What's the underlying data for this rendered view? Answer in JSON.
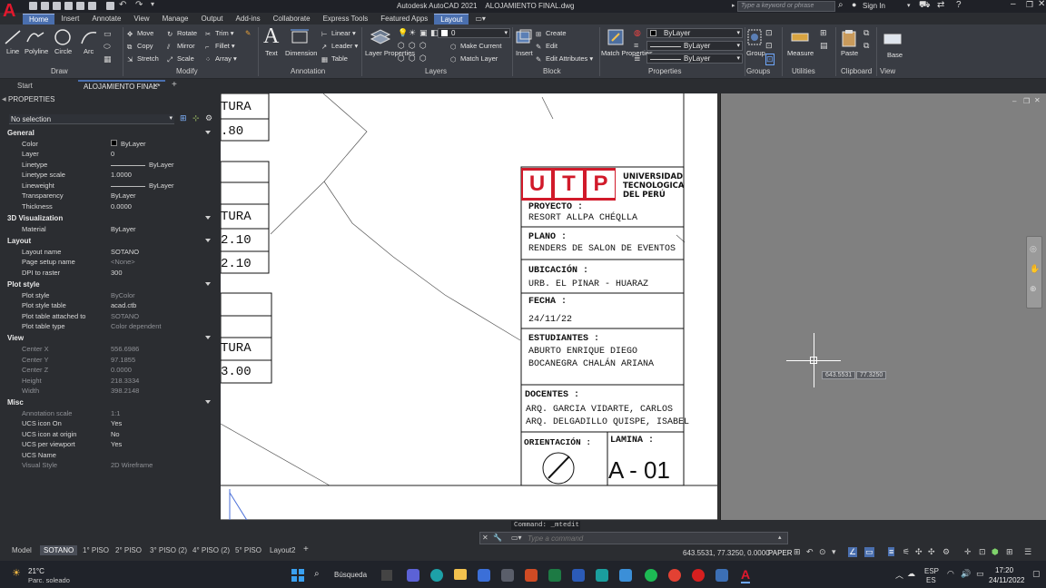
{
  "titlebar": {
    "app_title": "Autodesk AutoCAD 2021",
    "file_name": "ALOJAMIENTO FINAL.dwg",
    "search_placeholder": "Type a keyword or phrase",
    "sign_in": "Sign In"
  },
  "ribbon_tabs": [
    "Home",
    "Insert",
    "Annotate",
    "View",
    "Manage",
    "Output",
    "Add-ins",
    "Collaborate",
    "Express Tools",
    "Featured Apps",
    "Layout"
  ],
  "ribbon": {
    "draw": {
      "title": "Draw",
      "line": "Line",
      "polyline": "Polyline",
      "circle": "Circle",
      "arc": "Arc"
    },
    "modify": {
      "title": "Modify",
      "move": "Move",
      "rotate": "Rotate",
      "trim": "Trim",
      "copy": "Copy",
      "mirror": "Mirror",
      "fillet": "Fillet",
      "stretch": "Stretch",
      "scale": "Scale",
      "array": "Array"
    },
    "annotation": {
      "title": "Annotation",
      "text": "Text",
      "dimension": "Dimension",
      "linear": "Linear",
      "leader": "Leader",
      "table": "Table"
    },
    "layers": {
      "title": "Layers",
      "layer_properties": "Layer Properties",
      "current_layer": "0",
      "make_current": "Make Current",
      "match_layer": "Match Layer"
    },
    "block": {
      "title": "Block",
      "insert": "Insert",
      "create": "Create",
      "edit": "Edit",
      "edit_attributes": "Edit Attributes"
    },
    "properties": {
      "title": "Properties",
      "match_properties": "Match Properties",
      "color": "ByLayer",
      "lineweight": "ByLayer",
      "linetype": "ByLayer"
    },
    "groups": {
      "title": "Groups",
      "group": "Group"
    },
    "utilities": {
      "title": "Utilities",
      "measure": "Measure"
    },
    "clipboard": {
      "title": "Clipboard",
      "paste": "Paste"
    },
    "view": {
      "title": "View",
      "base": "Base"
    }
  },
  "doc_tabs": {
    "start": "Start",
    "active": "ALOJAMIENTO FINAL*"
  },
  "properties": {
    "title": "PROPERTIES",
    "selection": "No selection",
    "sections": {
      "general": "General",
      "viz3d": "3D Visualization",
      "layout": "Layout",
      "plotstyle": "Plot style",
      "view": "View",
      "misc": "Misc"
    },
    "rows": {
      "color": [
        "Color",
        "ByLayer"
      ],
      "layer": [
        "Layer",
        "0"
      ],
      "linetype": [
        "Linetype",
        "ByLayer"
      ],
      "linetype_scale": [
        "Linetype scale",
        "1.0000"
      ],
      "lineweight": [
        "Lineweight",
        "ByLayer"
      ],
      "transparency": [
        "Transparency",
        "ByLayer"
      ],
      "thickness": [
        "Thickness",
        "0.0000"
      ],
      "material": [
        "Material",
        "ByLayer"
      ],
      "layout_name": [
        "Layout name",
        "SOTANO"
      ],
      "page_setup": [
        "Page setup name",
        "<None>"
      ],
      "dpi": [
        "DPI to raster",
        "300"
      ],
      "plot_style": [
        "Plot style",
        "ByColor"
      ],
      "plot_style_table": [
        "Plot style table",
        "acad.ctb"
      ],
      "plot_attached": [
        "Plot table attached to",
        "SOTANO"
      ],
      "plot_type": [
        "Plot table type",
        "Color dependent"
      ],
      "center_x": [
        "Center X",
        "556.6986"
      ],
      "center_y": [
        "Center Y",
        "97.1855"
      ],
      "center_z": [
        "Center Z",
        "0.0000"
      ],
      "height": [
        "Height",
        "218.3334"
      ],
      "width": [
        "Width",
        "398.2148"
      ],
      "annotation_scale": [
        "Annotation scale",
        "1:1"
      ],
      "ucs_on": [
        "UCS icon On",
        "Yes"
      ],
      "ucs_origin": [
        "UCS icon at origin",
        "No"
      ],
      "ucs_viewport": [
        "UCS per viewport",
        "Yes"
      ],
      "ucs_name": [
        "UCS Name",
        ""
      ],
      "visual_style": [
        "Visual Style",
        "2D Wireframe"
      ]
    }
  },
  "drawing": {
    "left_labels": [
      "TURA",
      ".80",
      "TURA",
      "2.10",
      "2.10",
      "TURA",
      "3.00"
    ],
    "utp_letters": [
      "U",
      "T",
      "P"
    ],
    "university": [
      "UNIVERSIDAD",
      "TECNOLOGICA",
      "DEL PERÚ"
    ],
    "proyecto_label": "PROYECTO :",
    "proyecto_value": "RESORT ALLPA CHÉQLLA",
    "plano_label": "PLANO :",
    "plano_value": "RENDERS DE SALON DE EVENTOS",
    "ubicacion_label": "UBICACIÓN :",
    "ubicacion_value": "URB. EL PINAR - HUARAZ",
    "fecha_label": "FECHA :",
    "fecha_value": "24/11/22",
    "estudiantes_label": "ESTUDIANTES :",
    "estudiante_1": "ABURTO ENRIQUE DIEGO",
    "estudiante_2": "BOCANEGRA CHALÁN ARIANA",
    "docentes_label": "DOCENTES :",
    "docente_1": "ARQ. GARCIA VIDARTE, CARLOS",
    "docente_2": "ARQ. DELGADILLO QUISPE, ISABEL",
    "orientacion_label": "ORIENTACIÓN :",
    "lamina_label": "LAMINA :",
    "lamina_value": "A - 01",
    "cursor_x": "643.5531",
    "cursor_y": "77.3250"
  },
  "command": {
    "history": "Command: _mtedit",
    "placeholder": "Type a command"
  },
  "layout_tabs": [
    "Model",
    "SOTANO",
    "1° PISO",
    "2° PISO",
    "3° PISO (2)",
    "4° PISO (2)",
    "5° PISO",
    "Layout2"
  ],
  "status": {
    "coords": "643.5531, 77.3250, 0.0000",
    "paper": "PAPER"
  },
  "taskbar": {
    "weather_temp": "21°C",
    "weather_text": "Parc. soleado",
    "search": "Búsqueda",
    "lang_1": "ESP",
    "lang_2": "ES",
    "time": "17:20",
    "date": "24/11/2022"
  },
  "colors": {
    "accent": "#4a6fae",
    "utp_red": "#d11a2a",
    "autocad_red": "#e0182d"
  }
}
